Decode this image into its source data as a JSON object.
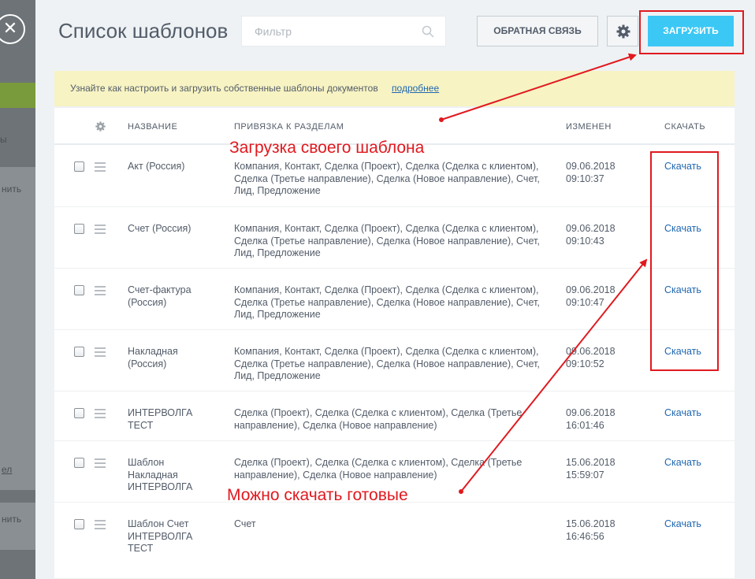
{
  "title": "Список шаблонов",
  "filter": {
    "placeholder": "Фильтр"
  },
  "buttons": {
    "feedback": "ОБРАТНАЯ СВЯЗЬ",
    "upload": "ЗАГРУЗИТЬ"
  },
  "notice": {
    "text": "Узнайте как настроить и загрузить собственные шаблоны документов",
    "link": "подробнее"
  },
  "table": {
    "headers": {
      "name": "НАЗВАНИЕ",
      "binding": "ПРИВЯЗКА К РАЗДЕЛАМ",
      "modified": "ИЗМЕНЕН",
      "download": "СКАЧАТЬ"
    },
    "rows": [
      {
        "name": "Акт (Россия)",
        "binding": "Компания, Контакт, Сделка (Проект), Сделка (Сделка с клиентом), Сделка (Третье направление), Сделка (Новое направление), Счет, Лид, Предложение",
        "date": "09.06.2018",
        "time": "09:10:37",
        "download": "Скачать"
      },
      {
        "name": "Счет (Россия)",
        "binding": "Компания, Контакт, Сделка (Проект), Сделка (Сделка с клиентом), Сделка (Третье направление), Сделка (Новое направление), Счет, Лид, Предложение",
        "date": "09.06.2018",
        "time": "09:10:43",
        "download": "Скачать"
      },
      {
        "name": "Счет-фактура (Россия)",
        "binding": "Компания, Контакт, Сделка (Проект), Сделка (Сделка с клиентом), Сделка (Третье направление), Сделка (Новое направление), Счет, Лид, Предложение",
        "date": "09.06.2018",
        "time": "09:10:47",
        "download": "Скачать"
      },
      {
        "name": "Накладная (Россия)",
        "binding": "Компания, Контакт, Сделка (Проект), Сделка (Сделка с клиентом), Сделка (Третье направление), Сделка (Новое направление), Счет, Лид, Предложение",
        "date": "09.06.2018",
        "time": "09:10:52",
        "download": "Скачать"
      },
      {
        "name": "ИНТЕРВОЛГА ТЕСТ",
        "binding": "Сделка (Проект), Сделка (Сделка с клиентом), Сделка (Третье направление), Сделка (Новое направление)",
        "date": "09.06.2018",
        "time": "16:01:46",
        "download": "Скачать"
      },
      {
        "name": "Шаблон Накладная ИНТЕРВОЛГА",
        "binding": "Сделка (Проект), Сделка (Сделка с клиентом), Сделка (Третье направление), Сделка (Новое направление)",
        "date": "15.06.2018",
        "time": "15:59:07",
        "download": "Скачать"
      },
      {
        "name": "Шаблон Счет ИНТЕРВОЛГА ТЕСТ",
        "binding": "Счет",
        "date": "15.06.2018",
        "time": "16:46:56",
        "download": "Скачать"
      }
    ]
  },
  "annotations": {
    "upload_hint": "Загрузка своего шаблона",
    "download_hint": "Можно скачать готовые"
  },
  "background": {
    "text1": "ы",
    "text2": "нить",
    "text3": "ел",
    "text4": "нить"
  },
  "colors": {
    "accent": "#3bc8f5",
    "annotation": "#e0191f",
    "link": "#2067b0",
    "notice_bg": "#f7f3c3"
  },
  "icons": [
    "close-icon",
    "search-icon",
    "gear-icon",
    "checkbox-icon",
    "drag-handle-icon"
  ]
}
